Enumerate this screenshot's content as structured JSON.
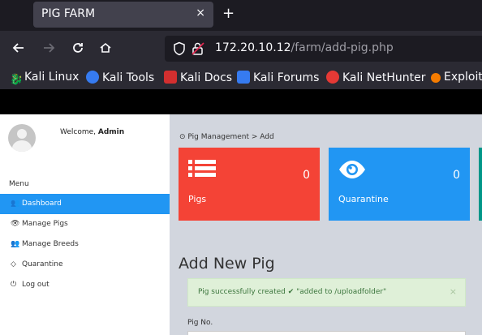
{
  "browser": {
    "tab_title": "PIG FARM",
    "tab_close": "×",
    "new_tab": "+",
    "url_host": "172.20.10.12",
    "url_path": "/farm/add-pig.php",
    "bookmarks": [
      "Kali Linux",
      "Kali Tools",
      "Kali Docs",
      "Kali Forums",
      "Kali NetHunter",
      "Exploit"
    ]
  },
  "sidebar": {
    "welcome_prefix": "Welcome, ",
    "username": "Admin",
    "menu_heading": "Menu",
    "items": [
      {
        "label": "Dashboard",
        "icon": "users-icon",
        "glyph": "👥"
      },
      {
        "label": "Manage Pigs",
        "icon": "eye-icon",
        "glyph": "👁"
      },
      {
        "label": "Manage Breeds",
        "icon": "users-icon",
        "glyph": "👥"
      },
      {
        "label": "Quarantine",
        "icon": "diamond-icon",
        "glyph": "◇"
      },
      {
        "label": "Log out",
        "icon": "power-icon",
        "glyph": "⏻"
      }
    ]
  },
  "main": {
    "breadcrumb": "Pig Management > Add",
    "cards": [
      {
        "label": "Pigs",
        "count": "0",
        "color": "#f44336",
        "icon": "list-icon"
      },
      {
        "label": "Quarantine",
        "count": "0",
        "color": "#2196f3",
        "icon": "eye-icon"
      }
    ],
    "page_title": "Add New Pig",
    "alert": {
      "message": "Pig successfully created",
      "check": "✔",
      "detail": "\"added to /uploadfolder\"",
      "close": "×"
    },
    "form": {
      "pig_no_label": "Pig No."
    }
  }
}
